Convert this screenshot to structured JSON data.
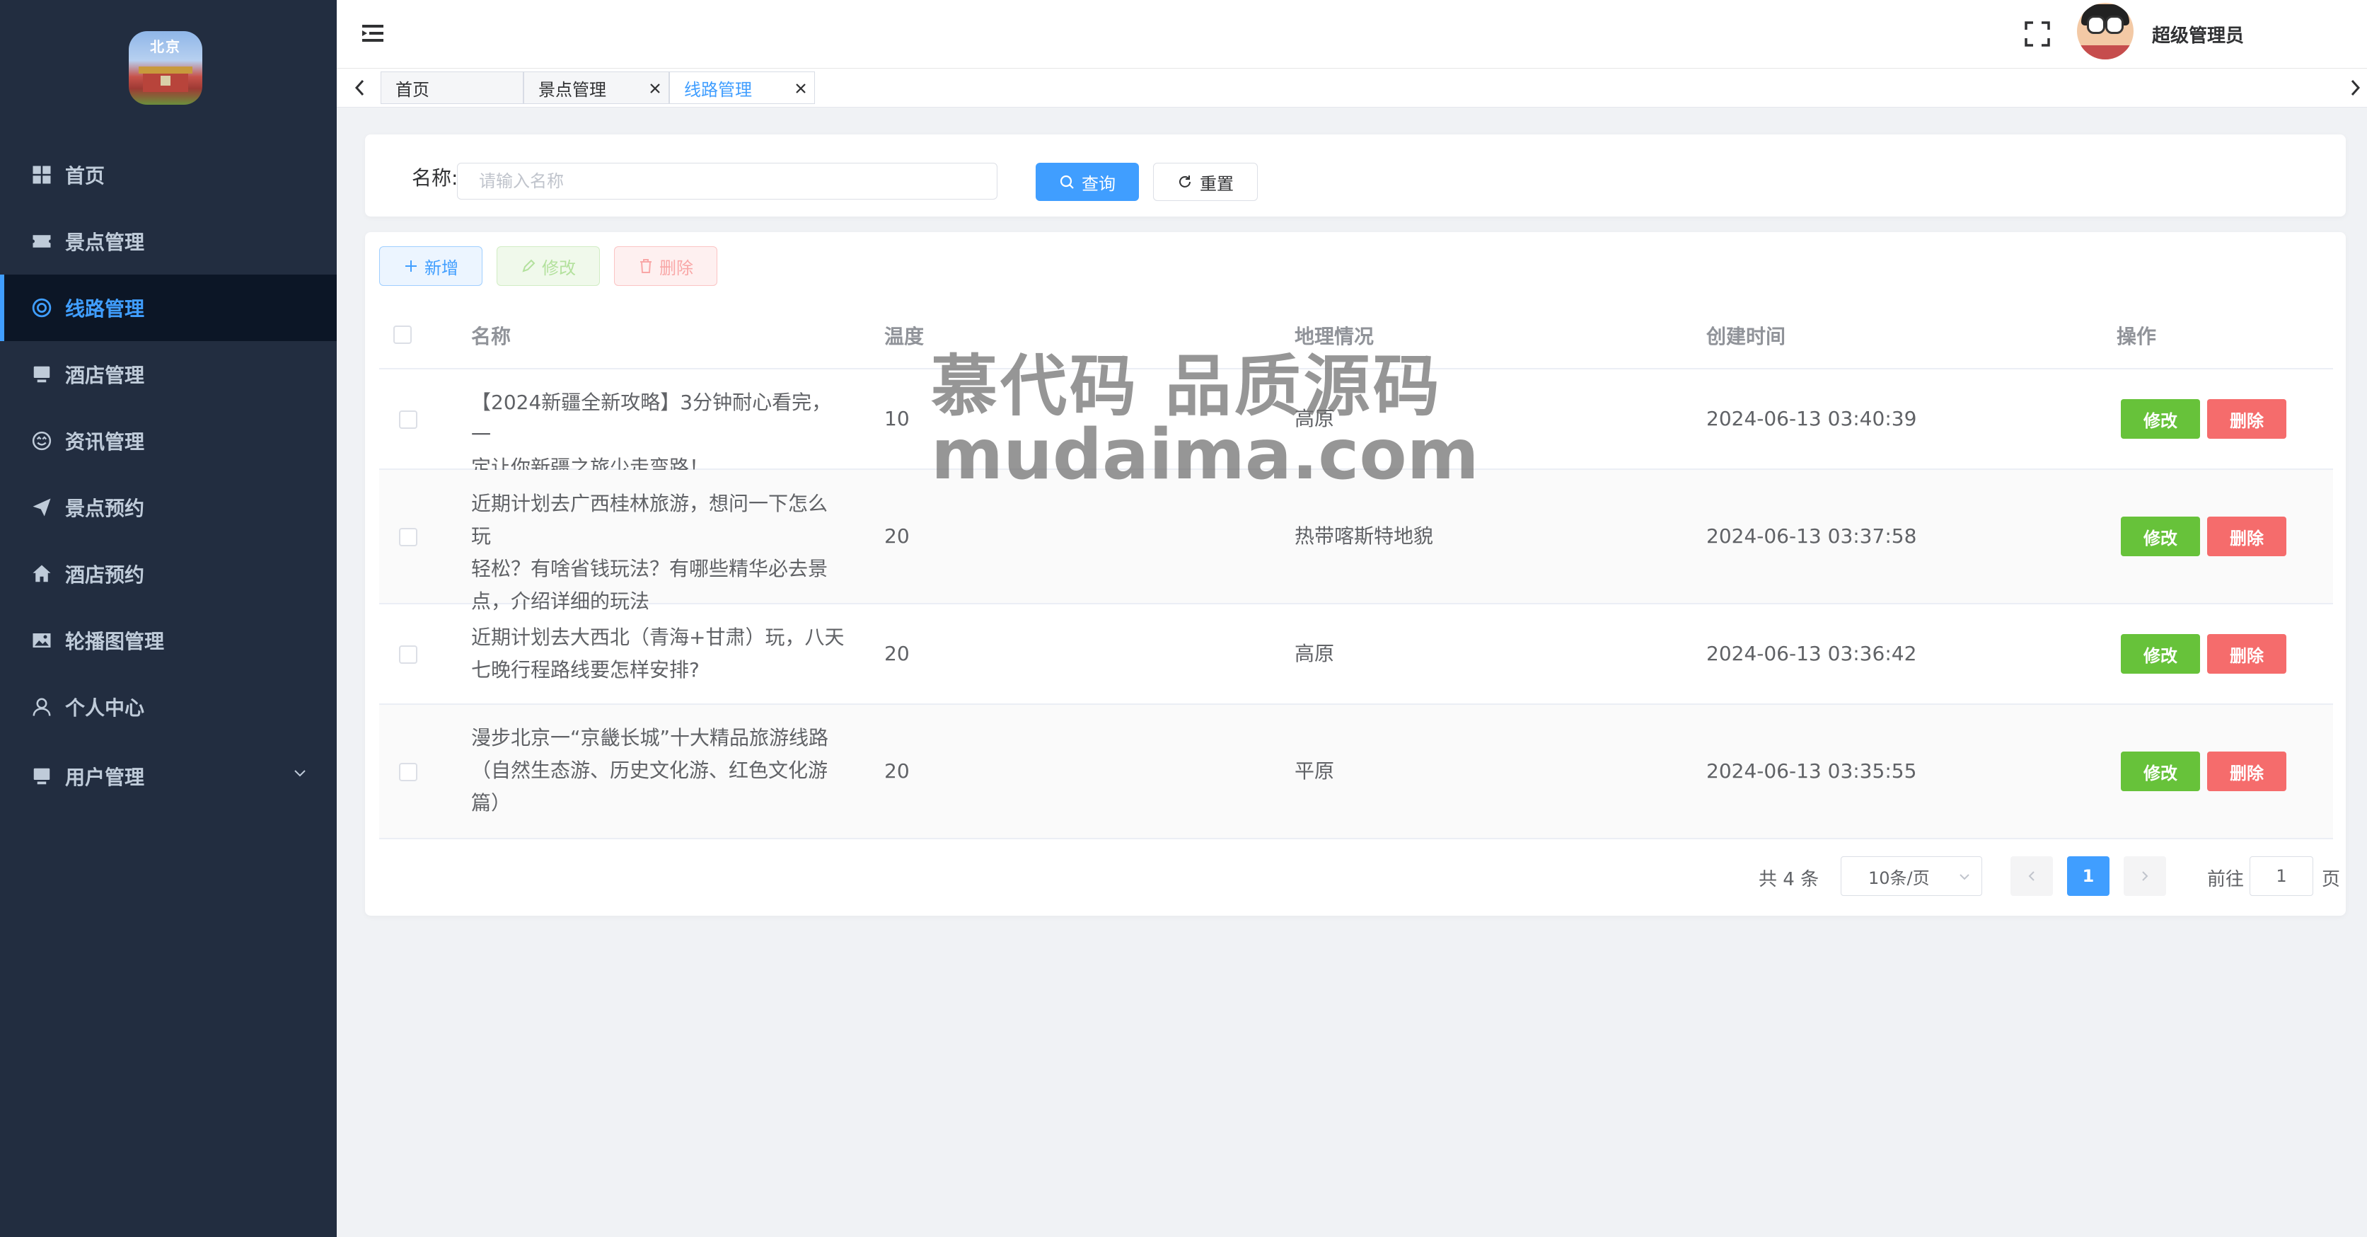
{
  "sidebar": {
    "logo_text": "北京",
    "items": [
      {
        "label": "首页",
        "icon": "dashboard-icon",
        "active": false
      },
      {
        "label": "景点管理",
        "icon": "ticket-icon",
        "active": false
      },
      {
        "label": "线路管理",
        "icon": "lifebuoy-icon",
        "active": true
      },
      {
        "label": "酒店管理",
        "icon": "monitor-icon",
        "active": false
      },
      {
        "label": "资讯管理",
        "icon": "smile-circle-icon",
        "active": false
      },
      {
        "label": "景点预约",
        "icon": "send-icon",
        "active": false
      },
      {
        "label": "酒店预约",
        "icon": "home-icon",
        "active": false
      },
      {
        "label": "轮播图管理",
        "icon": "picture-icon",
        "active": false
      },
      {
        "label": "个人中心",
        "icon": "user-icon",
        "active": false
      },
      {
        "label": "用户管理",
        "icon": "monitor-icon",
        "active": false,
        "has_submenu": true
      }
    ]
  },
  "header": {
    "user_name": "超级管理员"
  },
  "tags": [
    {
      "label": "首页",
      "closable": false,
      "active": false
    },
    {
      "label": "景点管理",
      "closable": true,
      "active": false
    },
    {
      "label": "线路管理",
      "closable": true,
      "active": true
    }
  ],
  "search": {
    "label": "名称:",
    "placeholder": "请输入名称",
    "query_button": "查询",
    "reset_button": "重置"
  },
  "toolbar": {
    "add": "新增",
    "edit": "修改",
    "delete": "删除"
  },
  "table": {
    "columns": [
      "名称",
      "温度",
      "地理情况",
      "创建时间",
      "操作"
    ],
    "rows": [
      {
        "name_lines": [
          "【2024新疆全新攻略】3分钟耐心看完，一",
          "定让你新疆之旅少走弯路！"
        ],
        "temperature": "10",
        "geography": "高原",
        "created": "2024-06-13 03:40:39"
      },
      {
        "name_lines": [
          "近期计划去广西桂林旅游，想问一下怎么玩",
          "轻松？有啥省钱玩法？有哪些精华必去景",
          "点，介绍详细的玩法"
        ],
        "temperature": "20",
        "geography": "热带喀斯特地貌",
        "created": "2024-06-13 03:37:58"
      },
      {
        "name_lines": [
          "近期计划去大西北（青海+甘肃）玩，八天",
          "七晚行程路线要怎样安排?"
        ],
        "temperature": "20",
        "geography": "高原",
        "created": "2024-06-13 03:36:42"
      },
      {
        "name_lines": [
          "漫步北京一“京畿长城”十大精品旅游线路",
          "（自然生态游、历史文化游、红色文化游",
          "篇）"
        ],
        "temperature": "20",
        "geography": "平原",
        "created": "2024-06-13 03:35:55"
      }
    ],
    "row_edit": "修改",
    "row_delete": "删除"
  },
  "pagination": {
    "total_text": "共 4 条",
    "page_size": "10条/页",
    "current_page": "1",
    "goto_label": "前往",
    "goto_value": "1",
    "goto_unit": "页"
  },
  "watermark": {
    "line1": "慕代码 品质源码",
    "line2": "mudaima.com"
  },
  "colors": {
    "sidebar_bg": "#222d40",
    "primary": "#409eff",
    "success": "#67c23a",
    "danger": "#f56c6c"
  }
}
